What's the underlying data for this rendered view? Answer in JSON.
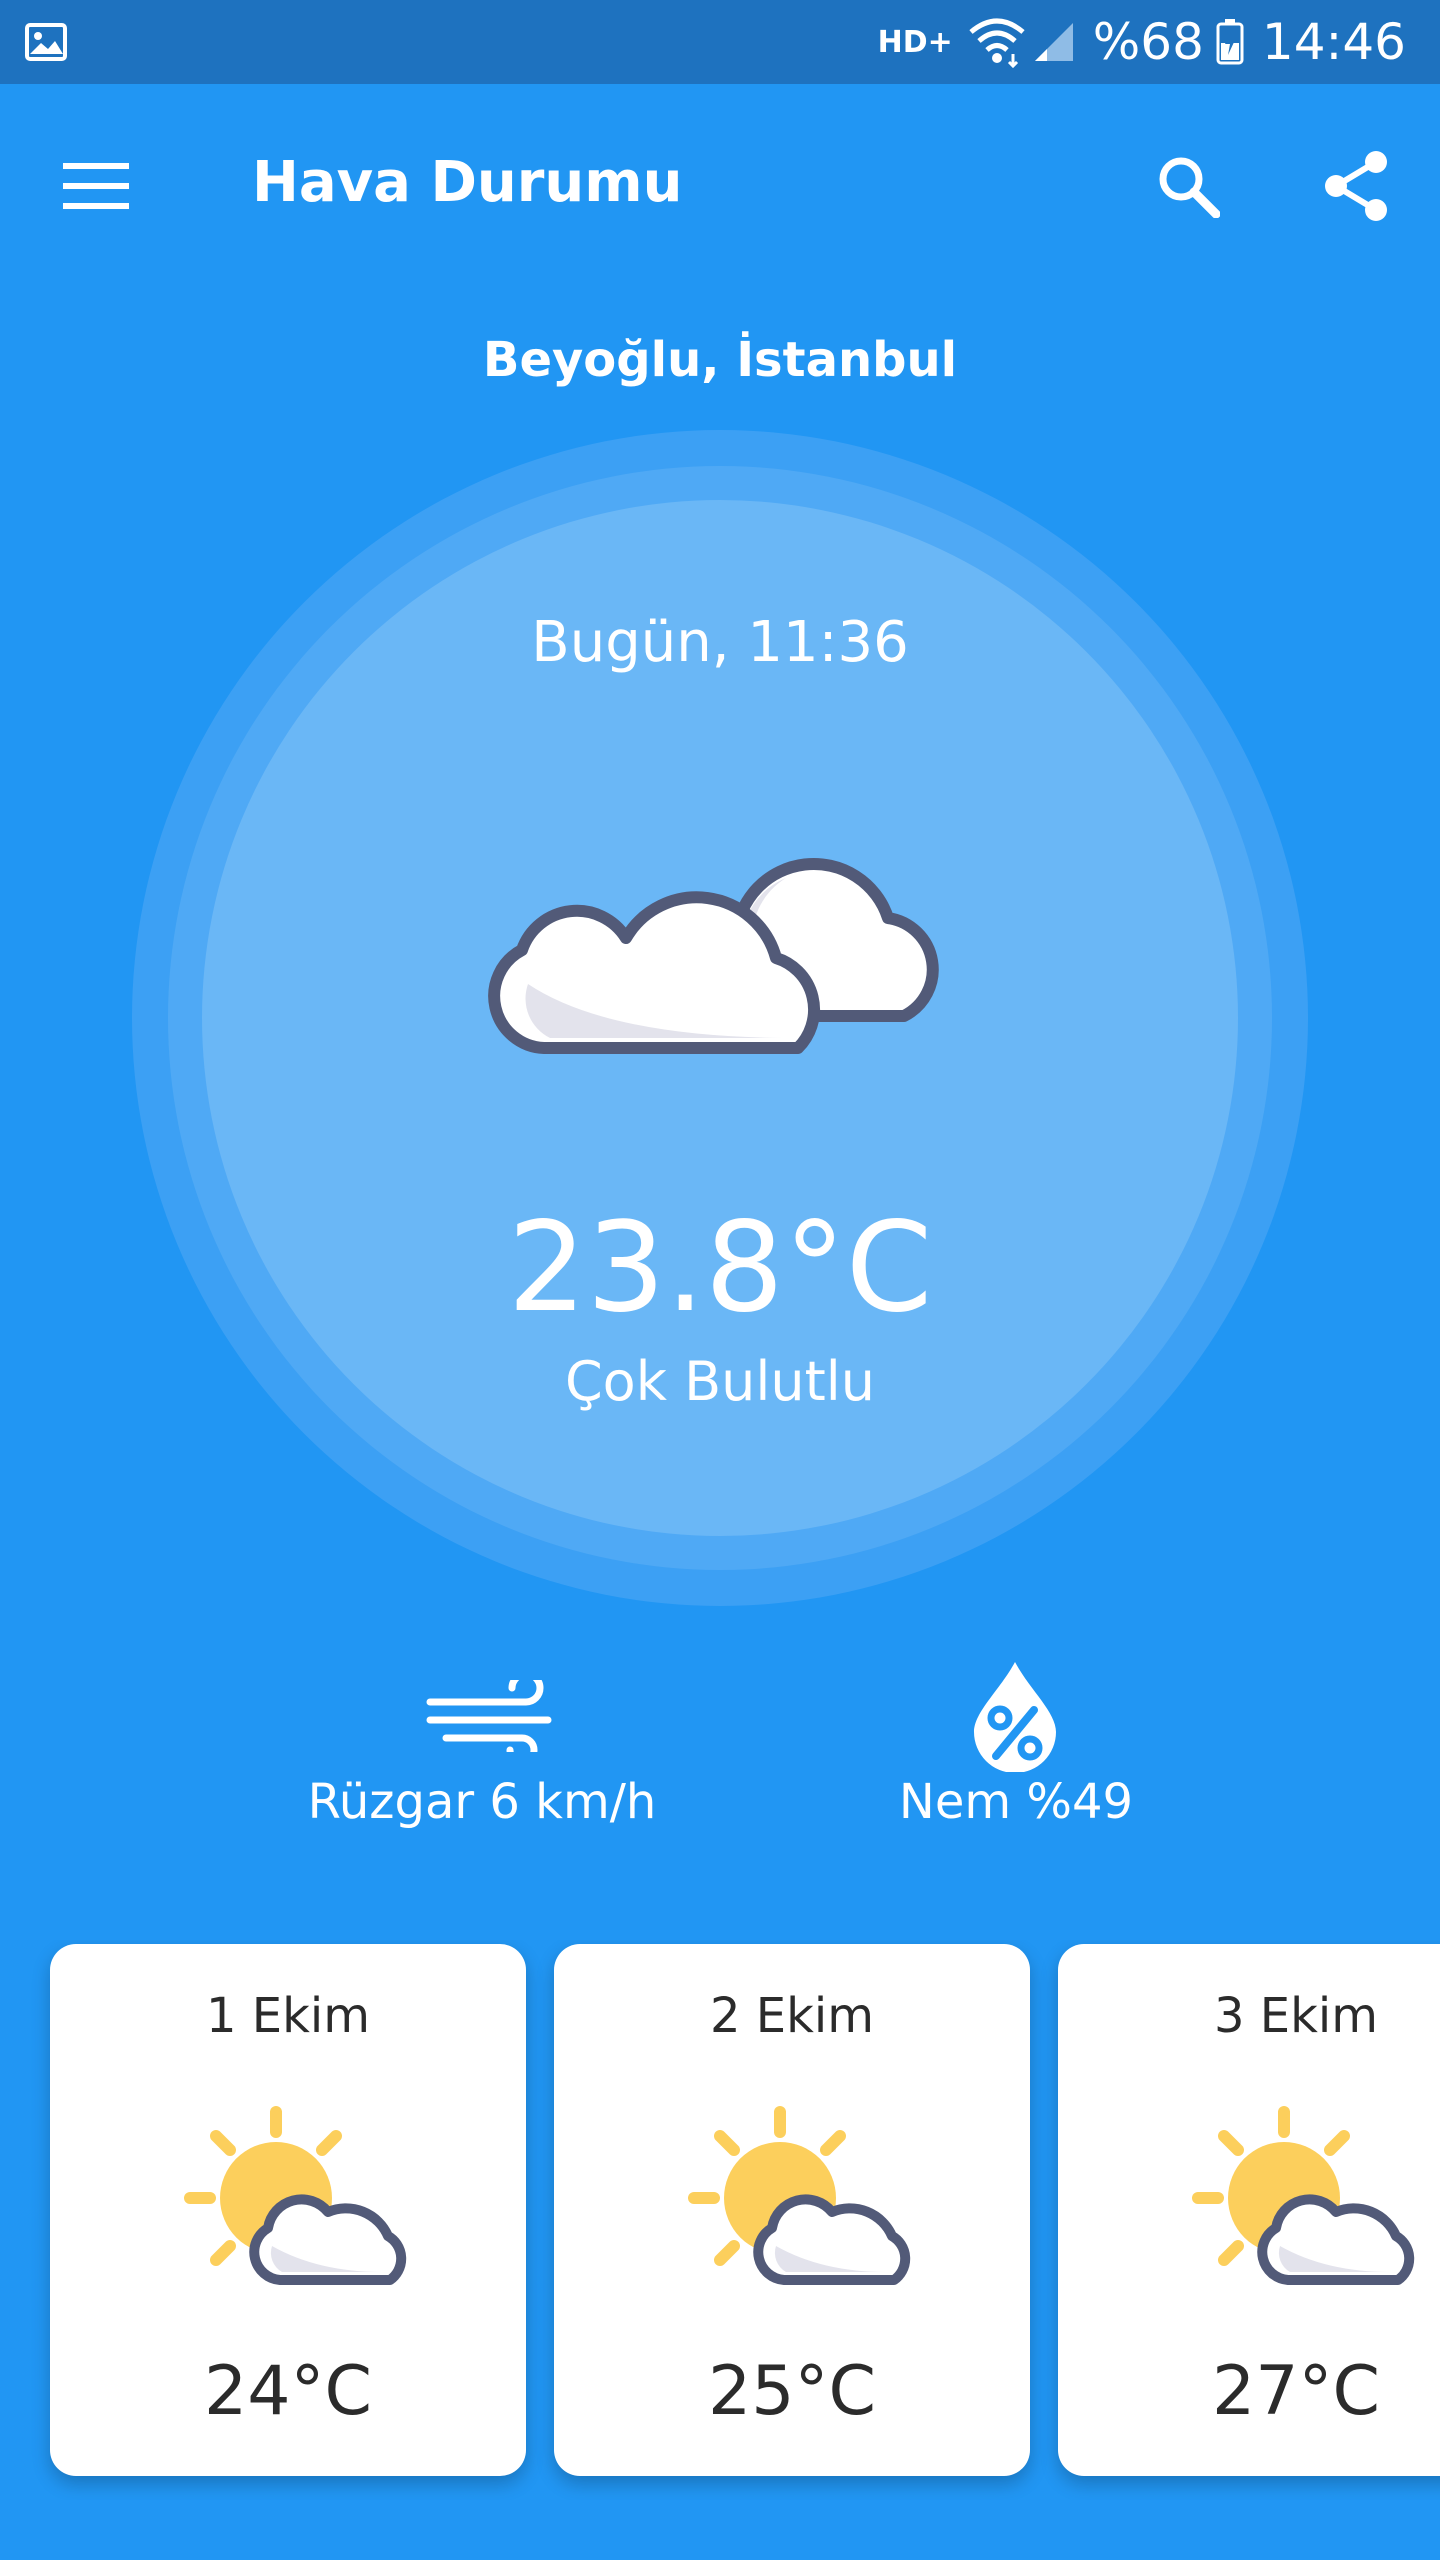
{
  "status_bar": {
    "network": "HD+",
    "battery": "%68",
    "time": "14:46"
  },
  "app_bar": {
    "title": "Hava Durumu"
  },
  "location": "Beyoğlu, İstanbul",
  "current": {
    "datetime": "Bugün, 11:36",
    "temperature": "23.8°C",
    "condition": "Çok Bulutlu",
    "icon": "clouds-icon"
  },
  "stats": {
    "wind": "Rüzgar 6 km/h",
    "humidity": "Nem %49"
  },
  "forecast": [
    {
      "date": "1 Ekim",
      "temp": "24°C",
      "icon": "partly-cloudy-icon"
    },
    {
      "date": "2 Ekim",
      "temp": "25°C",
      "icon": "partly-cloudy-icon"
    },
    {
      "date": "3 Ekim",
      "temp": "27°C",
      "icon": "partly-cloudy-icon"
    }
  ],
  "colors": {
    "background": "#2196F3",
    "status_bar": "#1E72BF",
    "circle_inner": "#6AB7F6",
    "icon_outline": "#525A78",
    "sun": "#FCCF5C"
  }
}
